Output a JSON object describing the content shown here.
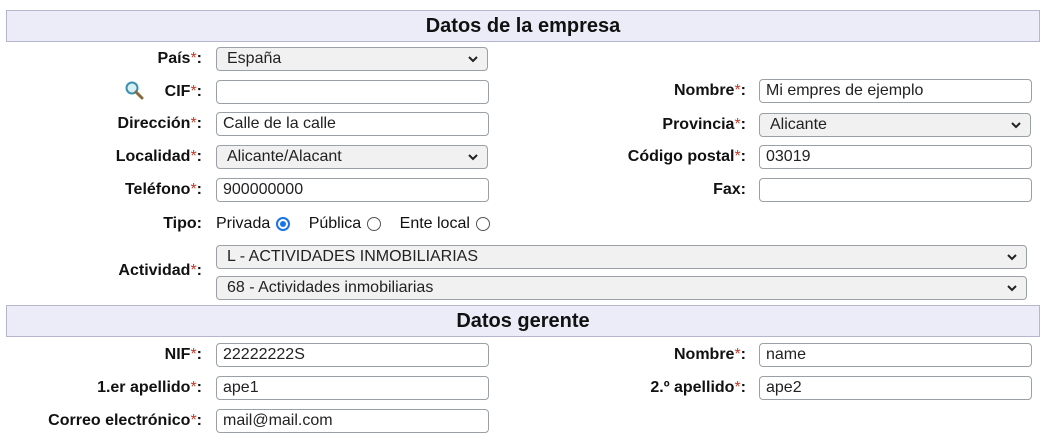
{
  "sections": {
    "empresa_title": "Datos de la empresa",
    "gerente_title": "Datos gerente"
  },
  "required_mark": "*",
  "colon": ":",
  "empresa": {
    "pais": {
      "label": "País",
      "value": "España"
    },
    "cif": {
      "label": "CIF",
      "value": ""
    },
    "nombre": {
      "label": "Nombre",
      "value": "Mi empres de ejemplo"
    },
    "direccion": {
      "label": "Dirección",
      "value": "Calle de la calle"
    },
    "provincia": {
      "label": "Provincia",
      "value": "Alicante"
    },
    "localidad": {
      "label": "Localidad",
      "value": "Alicante/Alacant"
    },
    "codigo_postal": {
      "label": "Código postal",
      "value": "03019"
    },
    "telefono": {
      "label": "Teléfono",
      "value": "900000000"
    },
    "fax": {
      "label": "Fax:",
      "value": ""
    },
    "tipo": {
      "label": "Tipo:",
      "options": [
        "Privada",
        "Pública",
        "Ente local"
      ],
      "selected": "Privada"
    },
    "actividad": {
      "label": "Actividad",
      "section_value": "L - ACTIVIDADES INMOBILIARIAS",
      "division_value": "68 - Actividades inmobiliarias"
    }
  },
  "gerente": {
    "nif": {
      "label": "NIF",
      "value": "22222222S"
    },
    "nombre": {
      "label": "Nombre",
      "value": "name"
    },
    "apellido1": {
      "label": "1.er apellido",
      "value": "ape1"
    },
    "apellido2": {
      "label": "2.º apellido",
      "value": "ape2"
    },
    "correo": {
      "label": "Correo electrónico",
      "value": "mail@mail.com"
    }
  },
  "colors": {
    "header_bg": "#ececf8",
    "required": "#c0392b",
    "radio_selected": "#1a73e8"
  },
  "icons": {
    "cif_search": "magnifier-icon",
    "dropdown": "chevron-down-icon"
  }
}
